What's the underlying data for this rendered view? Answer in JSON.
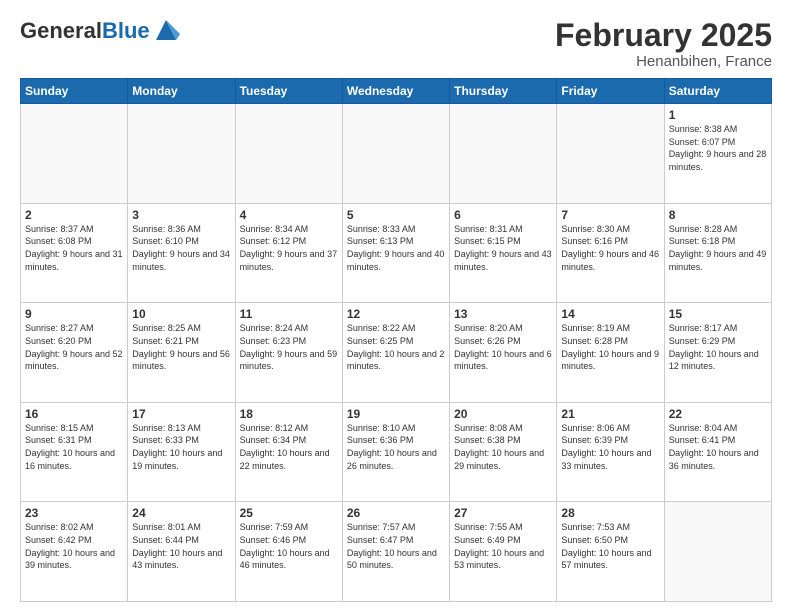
{
  "header": {
    "logo_general": "General",
    "logo_blue": "Blue",
    "month_title": "February 2025",
    "location": "Henanbihen, France"
  },
  "days_of_week": [
    "Sunday",
    "Monday",
    "Tuesday",
    "Wednesday",
    "Thursday",
    "Friday",
    "Saturday"
  ],
  "weeks": [
    [
      {
        "day": "",
        "info": ""
      },
      {
        "day": "",
        "info": ""
      },
      {
        "day": "",
        "info": ""
      },
      {
        "day": "",
        "info": ""
      },
      {
        "day": "",
        "info": ""
      },
      {
        "day": "",
        "info": ""
      },
      {
        "day": "1",
        "info": "Sunrise: 8:38 AM\nSunset: 6:07 PM\nDaylight: 9 hours and 28 minutes."
      }
    ],
    [
      {
        "day": "2",
        "info": "Sunrise: 8:37 AM\nSunset: 6:08 PM\nDaylight: 9 hours and 31 minutes."
      },
      {
        "day": "3",
        "info": "Sunrise: 8:36 AM\nSunset: 6:10 PM\nDaylight: 9 hours and 34 minutes."
      },
      {
        "day": "4",
        "info": "Sunrise: 8:34 AM\nSunset: 6:12 PM\nDaylight: 9 hours and 37 minutes."
      },
      {
        "day": "5",
        "info": "Sunrise: 8:33 AM\nSunset: 6:13 PM\nDaylight: 9 hours and 40 minutes."
      },
      {
        "day": "6",
        "info": "Sunrise: 8:31 AM\nSunset: 6:15 PM\nDaylight: 9 hours and 43 minutes."
      },
      {
        "day": "7",
        "info": "Sunrise: 8:30 AM\nSunset: 6:16 PM\nDaylight: 9 hours and 46 minutes."
      },
      {
        "day": "8",
        "info": "Sunrise: 8:28 AM\nSunset: 6:18 PM\nDaylight: 9 hours and 49 minutes."
      }
    ],
    [
      {
        "day": "9",
        "info": "Sunrise: 8:27 AM\nSunset: 6:20 PM\nDaylight: 9 hours and 52 minutes."
      },
      {
        "day": "10",
        "info": "Sunrise: 8:25 AM\nSunset: 6:21 PM\nDaylight: 9 hours and 56 minutes."
      },
      {
        "day": "11",
        "info": "Sunrise: 8:24 AM\nSunset: 6:23 PM\nDaylight: 9 hours and 59 minutes."
      },
      {
        "day": "12",
        "info": "Sunrise: 8:22 AM\nSunset: 6:25 PM\nDaylight: 10 hours and 2 minutes."
      },
      {
        "day": "13",
        "info": "Sunrise: 8:20 AM\nSunset: 6:26 PM\nDaylight: 10 hours and 6 minutes."
      },
      {
        "day": "14",
        "info": "Sunrise: 8:19 AM\nSunset: 6:28 PM\nDaylight: 10 hours and 9 minutes."
      },
      {
        "day": "15",
        "info": "Sunrise: 8:17 AM\nSunset: 6:29 PM\nDaylight: 10 hours and 12 minutes."
      }
    ],
    [
      {
        "day": "16",
        "info": "Sunrise: 8:15 AM\nSunset: 6:31 PM\nDaylight: 10 hours and 16 minutes."
      },
      {
        "day": "17",
        "info": "Sunrise: 8:13 AM\nSunset: 6:33 PM\nDaylight: 10 hours and 19 minutes."
      },
      {
        "day": "18",
        "info": "Sunrise: 8:12 AM\nSunset: 6:34 PM\nDaylight: 10 hours and 22 minutes."
      },
      {
        "day": "19",
        "info": "Sunrise: 8:10 AM\nSunset: 6:36 PM\nDaylight: 10 hours and 26 minutes."
      },
      {
        "day": "20",
        "info": "Sunrise: 8:08 AM\nSunset: 6:38 PM\nDaylight: 10 hours and 29 minutes."
      },
      {
        "day": "21",
        "info": "Sunrise: 8:06 AM\nSunset: 6:39 PM\nDaylight: 10 hours and 33 minutes."
      },
      {
        "day": "22",
        "info": "Sunrise: 8:04 AM\nSunset: 6:41 PM\nDaylight: 10 hours and 36 minutes."
      }
    ],
    [
      {
        "day": "23",
        "info": "Sunrise: 8:02 AM\nSunset: 6:42 PM\nDaylight: 10 hours and 39 minutes."
      },
      {
        "day": "24",
        "info": "Sunrise: 8:01 AM\nSunset: 6:44 PM\nDaylight: 10 hours and 43 minutes."
      },
      {
        "day": "25",
        "info": "Sunrise: 7:59 AM\nSunset: 6:46 PM\nDaylight: 10 hours and 46 minutes."
      },
      {
        "day": "26",
        "info": "Sunrise: 7:57 AM\nSunset: 6:47 PM\nDaylight: 10 hours and 50 minutes."
      },
      {
        "day": "27",
        "info": "Sunrise: 7:55 AM\nSunset: 6:49 PM\nDaylight: 10 hours and 53 minutes."
      },
      {
        "day": "28",
        "info": "Sunrise: 7:53 AM\nSunset: 6:50 PM\nDaylight: 10 hours and 57 minutes."
      },
      {
        "day": "",
        "info": ""
      }
    ]
  ]
}
